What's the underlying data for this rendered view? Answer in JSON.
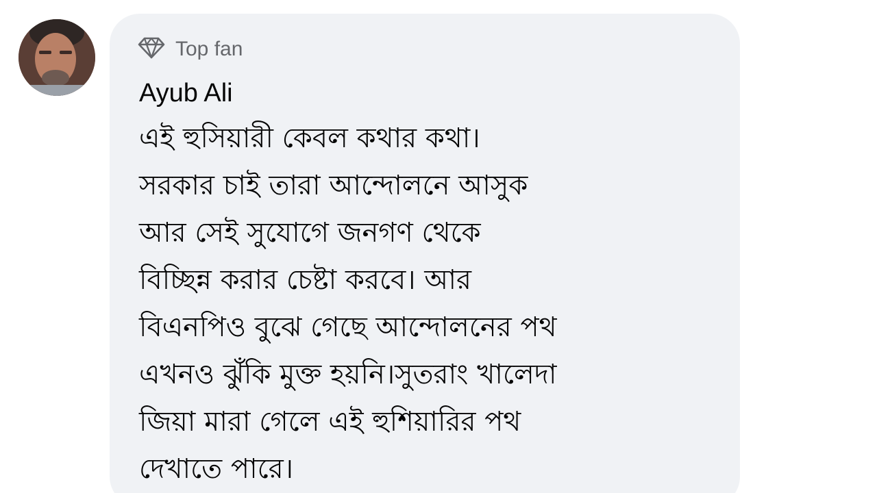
{
  "comment": {
    "badge": {
      "icon": "diamond-icon",
      "label": "Top fan"
    },
    "author": "Ayub Ali",
    "lines": [
      "এই হুসিয়ারী কেবল কথার কথা।",
      "সরকার চাই তারা আন্দোলনে আসুক",
      "আর সেই সুযোগে জনগণ থেকে",
      "বিচ্ছিন্ন করার চেষ্টা করবে। আর",
      "বিএনপিও বুঝে গেছে আন্দোলনের পথ",
      "এখনও ঝুঁকি মুক্ত হয়নি।সুতরাং খালেদা",
      "জিয়া মারা গেলে এই হুশিয়ারির পথ",
      "দেখাতে পারে।"
    ]
  },
  "colors": {
    "bubble_bg": "#f0f2f5",
    "author_text": "#050505",
    "badge_text": "#65676b"
  }
}
